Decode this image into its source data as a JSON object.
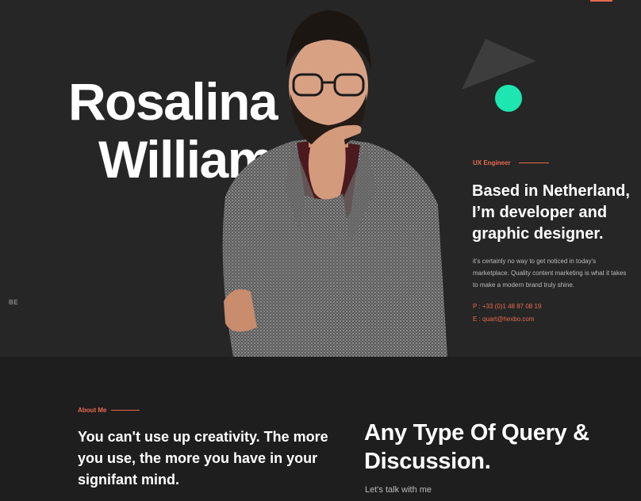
{
  "hero": {
    "name_first": "Rosalina",
    "name_last": "William",
    "side_label": "BE",
    "role": "UX Engineer",
    "headline": "Based in Netherland, I’m developer and graphic designer.",
    "description": "it's certainly no way to get noticed in today's marketplace. Quality content marketing is what it takes to make a modern brand truly shine.",
    "phone": "P : +33 (0)1 48 87 08 19",
    "email": "E : quart@hexbo.com"
  },
  "about": {
    "label": "About Me",
    "quote": "You can't use up creativity. The more you use, the more you have in your signifant mind."
  },
  "contact_section": {
    "heading": "Any Type Of Query & Discussion.",
    "subtext": "Let's talk with me"
  },
  "colors": {
    "accent": "#e86a4e",
    "mint": "#1de6b0",
    "hero_bg": "#262626",
    "page_bg": "#1e1e1e"
  }
}
